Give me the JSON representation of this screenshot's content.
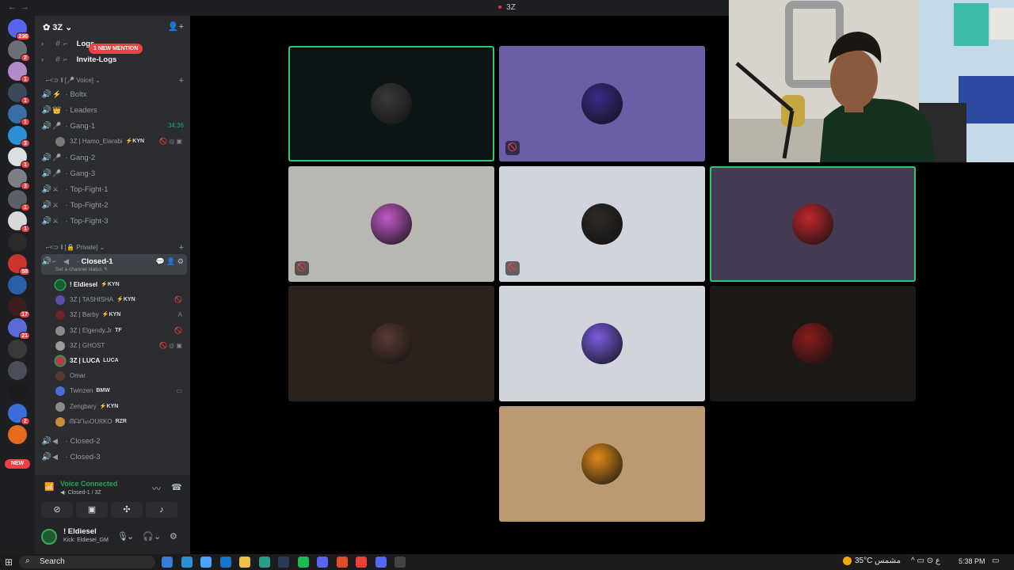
{
  "window": {
    "title": "3Z",
    "back": "←",
    "forward": "→"
  },
  "servers": [
    {
      "badge": "236",
      "color": "#5865f2"
    },
    {
      "badge": "2",
      "color": "#6d6f78"
    },
    {
      "badge": "1",
      "color": "#b58ac8"
    },
    {
      "badge": "1",
      "color": "#3a4a5a"
    },
    {
      "badge": "1",
      "color": "#3a6ea5"
    },
    {
      "badge": "3",
      "color": "#2e8fd9"
    },
    {
      "badge": "1",
      "color": "#dbdee1"
    },
    {
      "badge": "3",
      "color": "#7c7f86"
    },
    {
      "badge": "1",
      "color": "#5c5f66"
    },
    {
      "badge": "1",
      "color": "#d8d8d8"
    },
    {
      "badge": "",
      "color": "#2a2a2a"
    },
    {
      "badge": "58",
      "color": "#c9342c"
    },
    {
      "badge": "",
      "color": "#2b5fa8"
    },
    {
      "badge": "17",
      "color": "#3b1f1f"
    },
    {
      "badge": "21",
      "color": "#5a6ad8"
    },
    {
      "badge": "",
      "color": "#3a3a3a"
    },
    {
      "badge": "",
      "color": "#4a4e58"
    },
    {
      "badge": "",
      "color": "#1c1c1c"
    },
    {
      "badge": "2",
      "color": "#3a6ed8"
    },
    {
      "badge": "",
      "color": "#e66a1c"
    }
  ],
  "rail_new": "NEW",
  "sidebar": {
    "server_name": "3Z",
    "mention_pill": "1 NEW MENTION",
    "text_channels": [
      {
        "icon": "#",
        "label": "Logs"
      },
      {
        "icon": "#",
        "label": "Invite-Logs"
      }
    ],
    "voice_category": "Voice",
    "voice_channels": [
      {
        "label": "Boltx",
        "emoji": "⚡"
      },
      {
        "label": "Leaders",
        "emoji": "👑"
      },
      {
        "label": "Gang-1",
        "emoji": "🎤",
        "timer": "34:36"
      },
      {
        "label": "Gang-2",
        "emoji": "🎤"
      },
      {
        "label": "Gang-3",
        "emoji": "🎤"
      },
      {
        "label": "Top-Fight-1",
        "emoji": "⚔"
      },
      {
        "label": "Top-Fight-2",
        "emoji": "⚔"
      },
      {
        "label": "Top-Fight-3",
        "emoji": "⚔"
      }
    ],
    "gang1_member": {
      "name": "3Z | Hamo_Elarabi",
      "tag": "⚡KYN"
    },
    "private_category": "Private",
    "active_channel": {
      "label": "Closed-1",
      "status": "Set a channel status ✎"
    },
    "members": [
      {
        "name": "! Eldiesel",
        "tag": "⚡KYN",
        "bold": true,
        "speaking": true,
        "color": "#1d5a2c",
        "status": ""
      },
      {
        "name": "3Z | TASHISHA",
        "tag": "⚡KYN",
        "bold": false,
        "speaking": false,
        "color": "#5b4fa8",
        "status": "🚫"
      },
      {
        "name": "3Z | Barby",
        "tag": "⚡KYN",
        "bold": false,
        "speaking": false,
        "color": "#6a2626",
        "status": "A"
      },
      {
        "name": "3Z | Elgendy.Jr",
        "tag": "TF",
        "bold": false,
        "speaking": false,
        "color": "#8a8a8a",
        "status": "🚫"
      },
      {
        "name": "3Z | GHOST",
        "tag": "",
        "bold": false,
        "speaking": false,
        "color": "#9a9a9a",
        "status": "🚫 ◎ ▣"
      },
      {
        "name": "3Z | LUCA",
        "tag": "LUCA",
        "bold": true,
        "speaking": true,
        "color": "#b43c44",
        "status": ""
      },
      {
        "name": "Omar",
        "tag": "",
        "bold": false,
        "speaking": false,
        "color": "#5a3a30",
        "status": ""
      },
      {
        "name": "Twinzen",
        "tag": "BMW",
        "bold": false,
        "speaking": false,
        "color": "#4a6ed0",
        "status": "▭"
      },
      {
        "name": "Zengbary",
        "tag": "⚡KYN",
        "bold": false,
        "speaking": false,
        "color": "#8a8a8a",
        "status": ""
      },
      {
        "name": "ᗰᗩᑎᔕOᑌᖇKO",
        "tag": "RZR",
        "bold": false,
        "speaking": false,
        "color": "#c98a3a",
        "status": ""
      }
    ],
    "after_channels": [
      {
        "label": "Closed-2"
      },
      {
        "label": "Closed-3"
      }
    ]
  },
  "voice_panel": {
    "status": "Voice Connected",
    "channel": "Closed-1 / 3Z"
  },
  "user_panel": {
    "name": "! Eldiesel",
    "status": "Kick: Eldiesel_GM"
  },
  "tiles": [
    {
      "bg": "#0b1516",
      "avatar": "#3a3a3a",
      "speaking": true,
      "muted": false
    },
    {
      "bg": "#6a5fa6",
      "avatar": "#3a2b8c",
      "speaking": false,
      "muted": true
    },
    {
      "bg": "#b9b7b1",
      "avatar": "#c25ac7",
      "speaking": false,
      "muted": true
    },
    {
      "bg": "#cfd4dd",
      "avatar": "#2e2a26",
      "speaking": false,
      "muted": true
    },
    {
      "bg": "#453a54",
      "avatar": "#c1272d",
      "speaking": true,
      "muted": false
    },
    {
      "bg": "#2b211d",
      "avatar": "#5a3a34",
      "speaking": false,
      "muted": false
    },
    {
      "bg": "#cfd4dd",
      "avatar": "#7b5ce0",
      "speaking": false,
      "muted": false
    },
    {
      "bg": "#1b1815",
      "avatar": "#8a1c1c",
      "speaking": false,
      "muted": false
    },
    {
      "bg": "#b99a72",
      "avatar": "#e08a18",
      "speaking": false,
      "muted": false
    }
  ],
  "taskbar": {
    "search_placeholder": "Search",
    "weather": "35°C  مشمس",
    "tray": "^ ▭ ⊙ ع",
    "time": "5:38 PM",
    "apps": [
      {
        "color": "#3a7bd5"
      },
      {
        "color": "#2e8fd9"
      },
      {
        "color": "#4aa3ff"
      },
      {
        "color": "#1a73c8"
      },
      {
        "color": "#f2c14a"
      },
      {
        "color": "#2a9d8f"
      },
      {
        "color": "#2a3a5a"
      },
      {
        "color": "#1db954"
      },
      {
        "color": "#5865f2"
      },
      {
        "color": "#e34d26"
      },
      {
        "color": "#ea4335"
      },
      {
        "color": "#5865f2"
      },
      {
        "color": "#444"
      }
    ]
  }
}
